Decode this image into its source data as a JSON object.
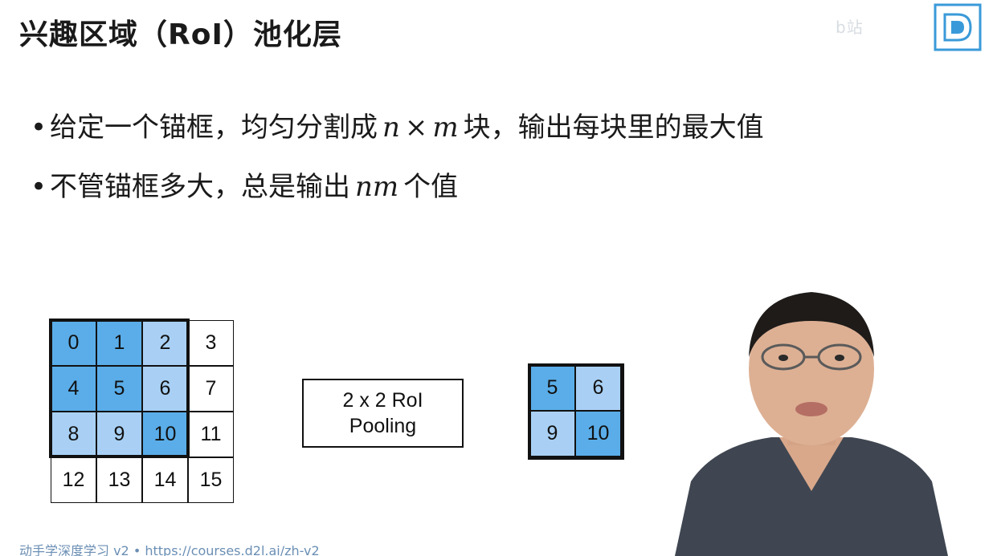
{
  "slide": {
    "title": "兴趣区域（RoI）池化层",
    "logo_text": "b站"
  },
  "bullets": [
    {
      "pre": "给定一个锚框，均匀分割成",
      "math_a": "n",
      "math_op": "×",
      "math_b": "m",
      "post": "块，输出每块里的最大值"
    },
    {
      "pre": "不管锚框多大，总是输出",
      "math": "nm",
      "post": "个值"
    }
  ],
  "diagram": {
    "input_cells": [
      "0",
      "1",
      "2",
      "3",
      "4",
      "5",
      "6",
      "7",
      "8",
      "9",
      "10",
      "11",
      "12",
      "13",
      "14",
      "15"
    ],
    "input_colors": [
      "#5aade8",
      "#5aade8",
      "#a9d0f4",
      "#ffffff",
      "#5aade8",
      "#5aade8",
      "#a9d0f4",
      "#ffffff",
      "#a9d0f4",
      "#a9d0f4",
      "#5aade8",
      "#ffffff",
      "#ffffff",
      "#ffffff",
      "#ffffff",
      "#ffffff"
    ],
    "pool_label_line1": "2 x 2 RoI",
    "pool_label_line2": "Pooling",
    "output_cells": [
      "5",
      "6",
      "9",
      "10"
    ],
    "output_colors": [
      "#5aade8",
      "#a9d0f4",
      "#a9d0f4",
      "#5aade8"
    ]
  },
  "footer": {
    "text": "动手学深度学习 v2 • https://courses.d2l.ai/zh-v2"
  }
}
